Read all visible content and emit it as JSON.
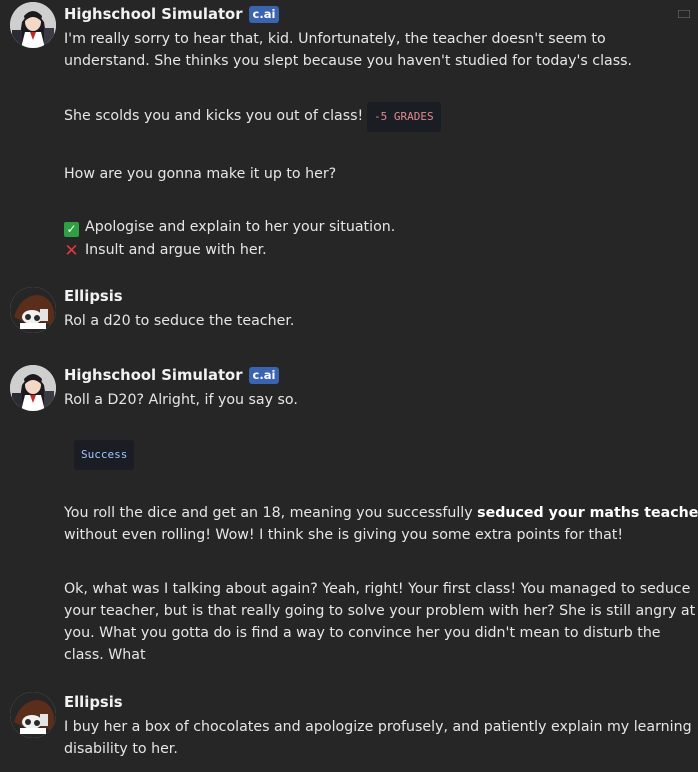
{
  "messages": [
    {
      "author": "Highschool Simulator",
      "badge": "c.ai",
      "lines": [
        "I'm really sorry to hear that, kid. Unfortunately, the teacher doesn't seem to",
        "understand. She thinks you slept because you haven't studied for today's class.",
        "She scolds you and kicks you out of class!",
        "How are you gonna make it up to her?"
      ],
      "penalty_tag": "-5 GRADES",
      "options": [
        {
          "icon": "check-icon",
          "text": "Apologise and explain to her your situation."
        },
        {
          "icon": "cross-icon",
          "text": "Insult and argue with her."
        }
      ]
    },
    {
      "author": "Ellipsis",
      "lines": [
        "Rol a d20 to seduce the teacher."
      ]
    },
    {
      "author": "Highschool Simulator",
      "badge": "c.ai",
      "lines": [
        "Roll a D20? Alright, if you say so."
      ],
      "result_tag": "Success",
      "para1": {
        "prefix": "You roll the dice and get an 18, meaning you successfully ",
        "bold": "seduced your maths teacher",
        "line2": "without even rolling! Wow! I think she is giving you some extra points for that!"
      },
      "para2": [
        "Ok, what was I talking about again? Yeah, right! Your first class! You managed to seduce",
        "your teacher, but is that really going to solve your problem with her? She is still angry at",
        "you. What you gotta do is find a way to convince her you didn't mean to disturb the",
        "class. What"
      ]
    },
    {
      "author": "Ellipsis",
      "lines": [
        "I buy her a box of chocolates and apologize profusely, and patiently explain my learning",
        "disability to her."
      ]
    }
  ]
}
